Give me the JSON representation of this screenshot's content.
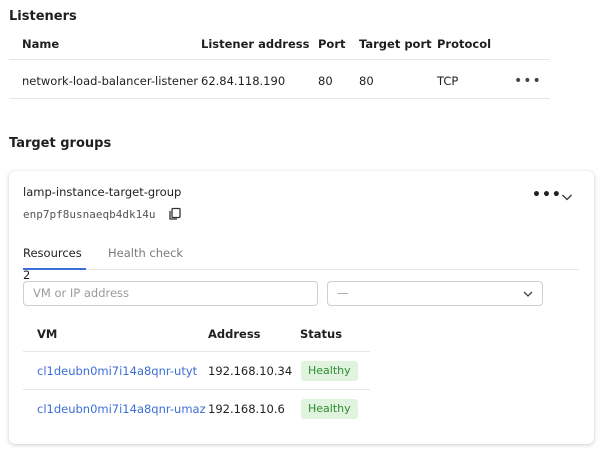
{
  "listeners": {
    "title": "Listeners",
    "columns": [
      "Name",
      "Listener address",
      "Port",
      "Target port",
      "Protocol"
    ],
    "rows": [
      {
        "name": "network-load-balancer-listener",
        "address": "62.84.118.190",
        "port": "80",
        "target_port": "80",
        "protocol": "TCP",
        "actions": "•••"
      }
    ]
  },
  "target_groups": {
    "title": "Target groups",
    "group": {
      "name": "lamp-instance-target-group",
      "id": "enp7pf8usnaeqb4dk14u",
      "actions": "•••",
      "tabs": [
        {
          "label": "Resources 2"
        },
        {
          "label": "Health check"
        }
      ],
      "search_placeholder": "VM or IP address",
      "filter_value": "—",
      "table": {
        "columns": [
          "VM",
          "Address",
          "Status"
        ],
        "rows": [
          {
            "vm": "cl1deubn0mi7i14a8qnr-utyt",
            "address": "192.168.10.34",
            "status": "Healthy"
          },
          {
            "vm": "cl1deubn0mi7i14a8qnr-umaz",
            "address": "192.168.10.6",
            "status": "Healthy"
          }
        ]
      }
    }
  },
  "colors": {
    "link": "#3c6ed6",
    "healthy_bg": "#dff3df",
    "healthy_text": "#2e8b2e"
  },
  "icons": [
    "copy-icon",
    "chevron-down-icon",
    "more-actions-icon"
  ]
}
